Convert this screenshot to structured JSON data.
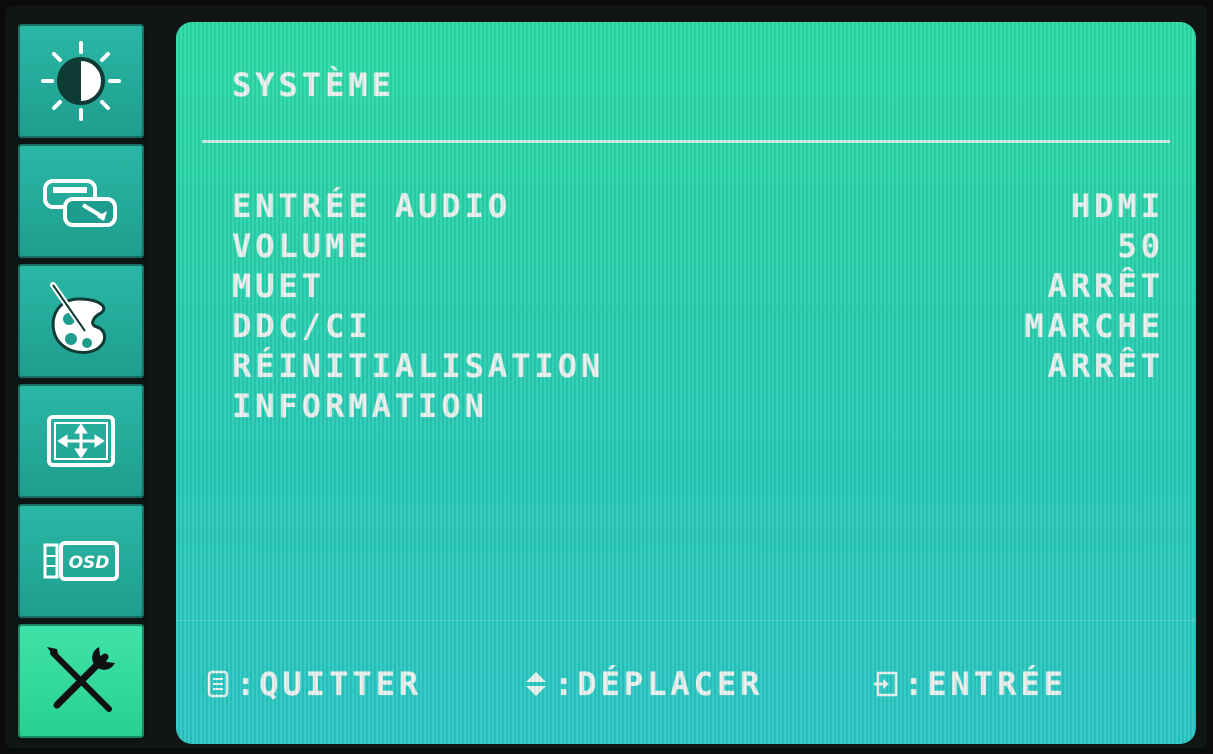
{
  "menu": {
    "title": "SYSTÈME",
    "items": [
      {
        "label": "ENTRÉE AUDIO",
        "value": "HDMI"
      },
      {
        "label": "VOLUME",
        "value": "50"
      },
      {
        "label": "MUET",
        "value": "ARRÊT"
      },
      {
        "label": "DDC/CI",
        "value": "MARCHE"
      },
      {
        "label": "RÉINITIALISATION",
        "value": "ARRÊT"
      },
      {
        "label": "INFORMATION",
        "value": ""
      }
    ]
  },
  "footer": {
    "quit": ":QUITTER",
    "move": ":DÉPLACER",
    "enter": ":ENTRÉE"
  },
  "sidebar": {
    "icons": [
      "brightness-contrast-icon",
      "input-source-icon",
      "color-palette-icon",
      "image-position-icon",
      "osd-settings-icon",
      "system-tools-icon"
    ],
    "active": "system-tools-icon",
    "osd_icon_text": "OSD"
  },
  "colors": {
    "panel_top": "#2fdca7",
    "panel_bottom": "#2cc8c6",
    "rail_button": "#1e9d8e",
    "rail_active": "#3fe3a9",
    "text": "#e9f2ef"
  }
}
